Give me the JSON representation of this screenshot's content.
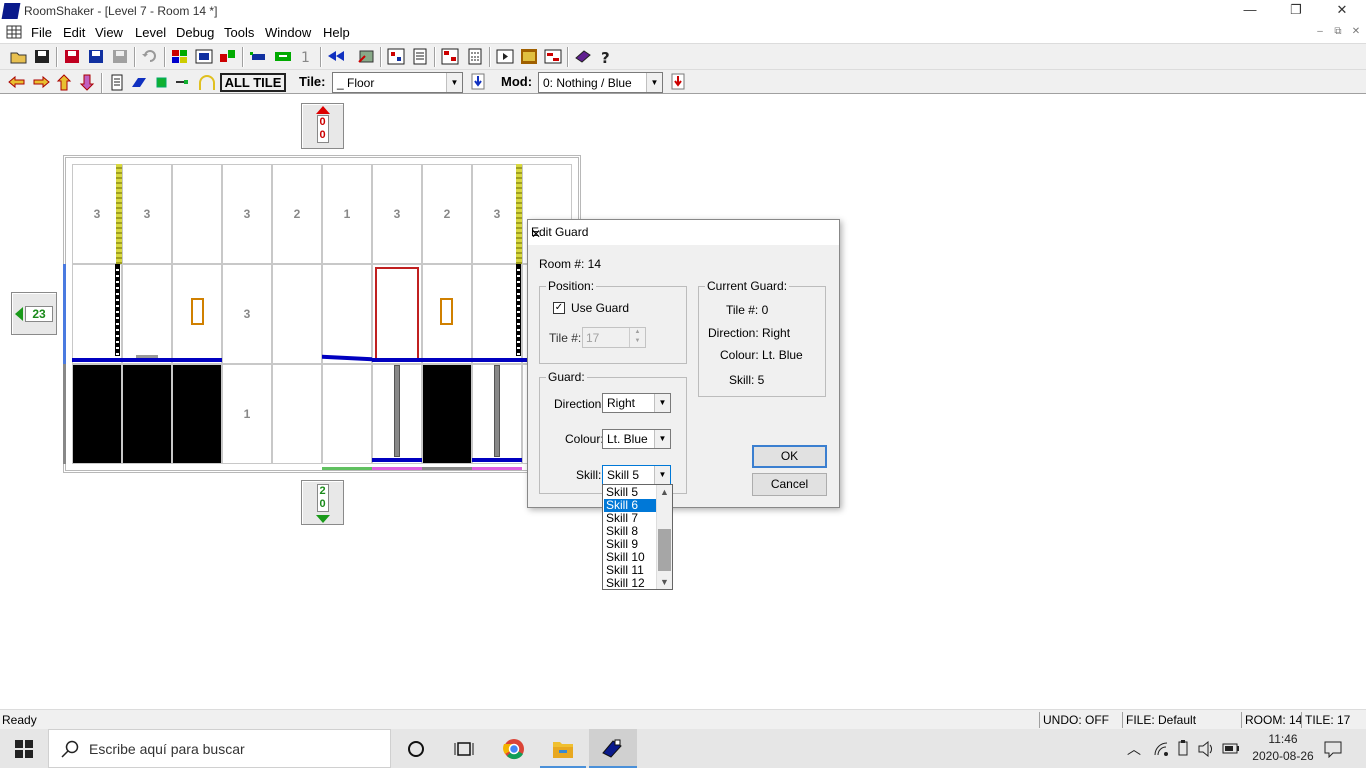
{
  "window": {
    "title": "RoomShaker - [Level 7 - Room 14 *]",
    "minimize": "—",
    "restore": "❐",
    "close": "✕"
  },
  "menu": {
    "items": [
      {
        "label": "File"
      },
      {
        "label": "Edit"
      },
      {
        "label": "View"
      },
      {
        "label": "Level"
      },
      {
        "label": "Debug"
      },
      {
        "label": "Tools"
      },
      {
        "label": "Window"
      },
      {
        "label": "Help"
      }
    ],
    "mdi_min": "–",
    "mdi_restore": "⧉",
    "mdi_close": "✕"
  },
  "toolbar2": {
    "all_tile_label": "ALL TILE",
    "tile_label": "Tile:",
    "tile_value": "_ Floor",
    "mod_label": "Mod:",
    "mod_value": "0: Nothing / Blue"
  },
  "nav": {
    "up": "0",
    "up2": "0",
    "left": "23",
    "down": "2",
    "down2": "0"
  },
  "room": {
    "row1": [
      "3",
      "3",
      "",
      "3",
      "2",
      "1",
      "3",
      "2",
      "3",
      ""
    ],
    "row2": [
      "",
      "",
      "",
      "3",
      "",
      "",
      "",
      "",
      "",
      ""
    ],
    "row3": [
      "",
      "",
      "",
      "1",
      "",
      "",
      "",
      "",
      "",
      ""
    ]
  },
  "dialog": {
    "title": "Edit Guard",
    "room_label": "Room #: 14",
    "position_group": "Position:",
    "use_guard_label": "Use Guard",
    "use_guard_checked": "✓",
    "tile_label": "Tile #:",
    "tile_value": "17",
    "guard_group": "Guard:",
    "direction_label": "Direction:",
    "direction_value": "Right",
    "colour_label": "Colour:",
    "colour_value": "Lt. Blue",
    "skill_label": "Skill:",
    "skill_value": "Skill  5",
    "current_group": "Current Guard:",
    "current_tile": "Tile #: 0",
    "current_direction": "Direction: Right",
    "current_colour": "Colour: Lt. Blue",
    "current_skill": "Skill: 5",
    "ok": "OK",
    "cancel": "Cancel",
    "skill_options": [
      "Skill  5",
      "Skill  6",
      "Skill  7",
      "Skill  8",
      "Skill  9",
      "Skill 10",
      "Skill 11",
      "Skill 12"
    ],
    "skill_selected_index": 1
  },
  "status": {
    "ready": "Ready",
    "undo": "UNDO: OFF",
    "file": "FILE: Default",
    "room": "ROOM: 14",
    "tile": "TILE: 17"
  },
  "taskbar": {
    "search_placeholder": "Escribe aquí para buscar",
    "time": "11:46",
    "date": "2020-08-26"
  },
  "colors": {
    "floor_blue": "#0000c0",
    "column_yellow": "#c8c828",
    "door_red": "#c00000",
    "torch_orange": "#d08000",
    "selection": "#0078d7"
  }
}
